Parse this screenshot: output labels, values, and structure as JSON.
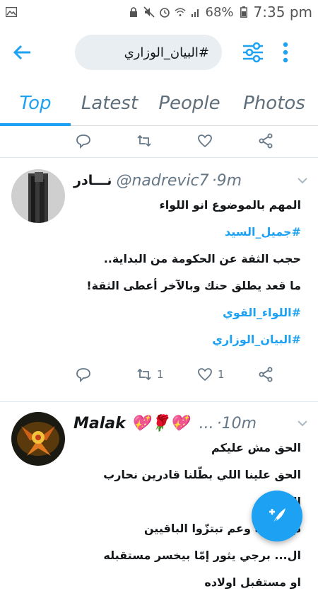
{
  "status_bar": {
    "battery_percent": "68%",
    "time": "7:35 pm"
  },
  "search": {
    "query": "#البيان_الوزاري"
  },
  "tabs": [
    {
      "label": "Top",
      "active": true
    },
    {
      "label": "Latest",
      "active": false
    },
    {
      "label": "People",
      "active": false
    },
    {
      "label": "Photos",
      "active": false
    }
  ],
  "tweets": [
    {
      "display_name": "نـــادر",
      "handle": "@nadrevic7",
      "time": "·9m",
      "lines": [
        "المهم بالموضوع انو اللواء",
        "حجب الثقة عن الحكومة من البداية..",
        "ما قعد يطلق حنك وبالآخر أعطى الثقة!"
      ],
      "hashtags": [
        "#جميل_السيد",
        "#اللواء_القوي",
        "#البيان_الوزاري"
      ],
      "retweet_count": "1",
      "like_count": "1"
    },
    {
      "display_name": "Malak 💖🌹💖",
      "handle": "...",
      "time": "·10m",
      "lines": [
        "الحق مش عليكم",
        "الحق علينا اللي بطّلنا قادرين نحارب",
        "الذل",
        "دخّ غلبية وعم تبتزّوا الباقيين",
        "ال... برجي يثور إمّا بيخسر مستقبله",
        "او مستقبل اولاده"
      ]
    }
  ],
  "colors": {
    "accent": "#1da1f2",
    "text_secondary": "#657786"
  }
}
